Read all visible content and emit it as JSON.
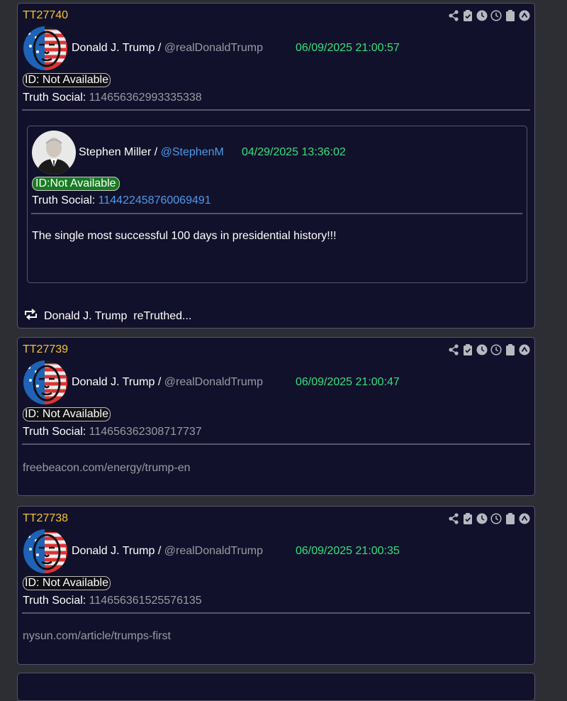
{
  "posts": [
    {
      "post_id": "TT27740",
      "author_name": "Donald J. Trump",
      "separator": "/",
      "handle": "@realDonaldTrump",
      "timestamp": "06/09/2025 21:00:57",
      "id_badge": "ID: Not Available",
      "truth_social_label": "Truth Social:",
      "truth_social_id": "114656362993335338",
      "quote": {
        "author_name": "Stephen Miller",
        "separator": "/",
        "handle": "@StephenM",
        "timestamp": "04/29/2025 13:36:02",
        "id_badge": "ID:Not Available",
        "truth_social_label": "Truth Social:",
        "truth_social_id": "114422458760069491",
        "body": "The single most successful 100 days in presidential history!!!"
      },
      "retruth_text": "Donald J. Trump  reTruthed..."
    },
    {
      "post_id": "TT27739",
      "author_name": "Donald J. Trump",
      "separator": "/",
      "handle": "@realDonaldTrump",
      "timestamp": "06/09/2025 21:00:47",
      "id_badge": "ID: Not Available",
      "truth_social_label": "Truth Social:",
      "truth_social_id": "114656362308717737",
      "link": "freebeacon.com/energy/trump-en"
    },
    {
      "post_id": "TT27738",
      "author_name": "Donald J. Trump",
      "separator": "/",
      "handle": "@realDonaldTrump",
      "timestamp": "06/09/2025 21:00:35",
      "id_badge": "ID: Not Available",
      "truth_social_label": "Truth Social:",
      "truth_social_id": "114656361525576135",
      "link": "nysun.com/article/trumps-first"
    }
  ],
  "toolbar_icons": [
    "share-icon",
    "clipboard-check-icon",
    "clock-solid-icon",
    "clock-outline-icon",
    "clipboard-icon",
    "scroll-up-icon"
  ],
  "colors": {
    "post_id": "#f2c530",
    "timestamp": "#33e07e",
    "handle_link": "#4b9be8",
    "card_bg": "#12112b",
    "page_bg": "#2d2d34"
  }
}
